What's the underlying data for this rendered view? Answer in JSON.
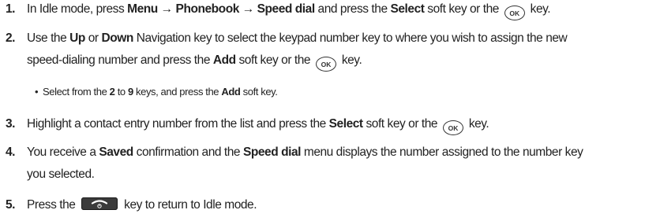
{
  "steps": [
    {
      "num": "1.",
      "t1": "In Idle mode, press ",
      "b1": "Menu → Phonebook → Speed dial",
      "t2": " and press the ",
      "b2": "Select",
      "t3": " soft key or the",
      "t4": "key."
    },
    {
      "num": "2.",
      "t1": "Use the ",
      "b1": "Up",
      "t2": " or ",
      "b2": "Down",
      "t3": " Navigation key to select the keypad number key to where you wish to assign the new",
      "l2a": "speed-dialing number and press the ",
      "l2b": "Add",
      "l2c": " soft key or the",
      "l2d": "key."
    },
    {
      "num": "3.",
      "t1": "Highlight a contact entry number from the list and press the ",
      "b1": "Select",
      "t2": " soft key or the",
      "t3": "key."
    },
    {
      "num": "4.",
      "t1": "You receive a ",
      "b1": "Saved",
      "t2": " confirmation and the ",
      "b2": "Speed dial",
      "t3": " menu displays the number assigned to the number key",
      "l2": "you selected."
    },
    {
      "num": "5.",
      "t1": "Press the",
      "t2": "key to return to Idle mode."
    }
  ],
  "sub_bullet": {
    "bullet": "•",
    "t1": "Select from the ",
    "b1": "2",
    "t2": " to ",
    "b2": "9",
    "t3": " keys, and press the ",
    "b3": "Add",
    "t4": " soft key."
  },
  "keys": {
    "ok_label": "OK",
    "ok_icon": "ok-key-icon",
    "end_icon": "end-power-key-icon"
  }
}
